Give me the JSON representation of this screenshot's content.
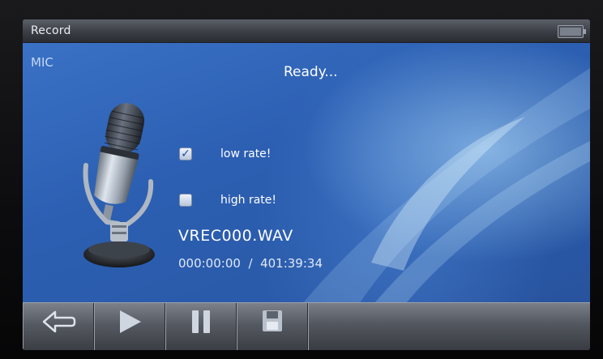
{
  "window": {
    "title": "Record"
  },
  "source": {
    "label": "MIC"
  },
  "status": {
    "text": "Ready..."
  },
  "options": [
    {
      "label": "low rate!",
      "checked": true
    },
    {
      "label": "high rate!",
      "checked": false
    }
  ],
  "recording": {
    "filename": "VREC000.WAV",
    "elapsed": "000:00:00",
    "separator": "/",
    "remaining": "401:39:34"
  },
  "toolbar": {
    "buttons": [
      {
        "icon": "back-arrow-icon"
      },
      {
        "icon": "play-icon"
      },
      {
        "icon": "pause-icon"
      },
      {
        "icon": "save-icon"
      }
    ]
  },
  "colors": {
    "background_blue": "#2c5fb2",
    "titlebar_gray": "#3b3e45",
    "text_white": "#ffffff"
  }
}
